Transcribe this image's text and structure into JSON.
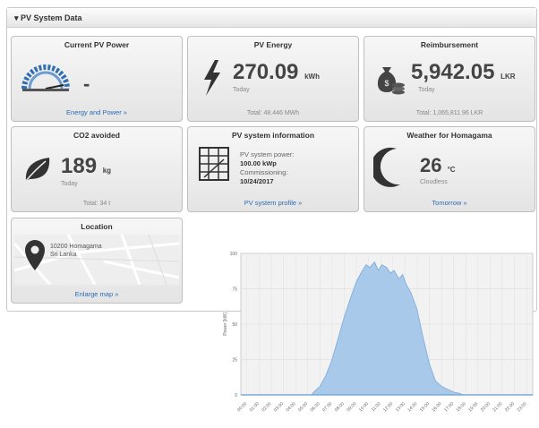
{
  "panel": {
    "title": "▾ PV System Data"
  },
  "cards": {
    "current_power": {
      "title": "Current PV Power",
      "value": "-",
      "link": "Energy and Power »"
    },
    "pv_energy": {
      "title": "PV Energy",
      "value": "270.09",
      "unit": "kWh",
      "period": "Today",
      "total": "Total: 48.446 MWh"
    },
    "reimbursement": {
      "title": "Reimbursement",
      "value": "5,942.05",
      "unit": "LKR",
      "period": "Today",
      "total": "Total: 1,065,811.96 LKR"
    },
    "co2": {
      "title": "CO2 avoided",
      "value": "189",
      "unit": "kg",
      "period": "Today",
      "total": "Total: 34 t"
    },
    "system_info": {
      "title": "PV system information",
      "line1": "PV system power:",
      "line2": "100.00 kWp",
      "line3": "Commissioning:",
      "line4": "10/24/2017",
      "link": "PV system profile »"
    },
    "weather": {
      "title": "Weather for Homagama",
      "value": "26",
      "unit": "°C",
      "condition": "Cloudless",
      "link": "Tomorrow »"
    },
    "location": {
      "title": "Location",
      "line1": "10200 Homagama",
      "line2": "Sri Lanka",
      "link": "Enlarge map »"
    }
  },
  "colors": {
    "accent_link": "#2a6bb5",
    "chart_fill": "#a9c9ea",
    "chart_stroke": "#7ba9d8"
  },
  "icons": {
    "gauge": "gauge-icon",
    "bolt": "lightning-bolt-icon",
    "money": "money-bag-icon",
    "leaf": "leaf-icon",
    "solar": "solar-panel-icon",
    "moon": "moon-icon",
    "pin": "location-pin-icon"
  },
  "chart_data": {
    "type": "area",
    "ylabel": "Power [kW]",
    "yticks": [
      "0",
      "25",
      "50",
      "75",
      "100"
    ],
    "ylim": [
      0,
      100
    ],
    "xticks": [
      "00:00",
      "01:00",
      "02:00",
      "03:00",
      "04:00",
      "05:00",
      "06:00",
      "07:00",
      "08:00",
      "09:00",
      "10:00",
      "11:00",
      "12:00",
      "13:00",
      "14:00",
      "15:00",
      "16:00",
      "17:00",
      "18:00",
      "19:00",
      "20:00",
      "21:00",
      "22:00",
      "23:00"
    ],
    "x": [
      0,
      5.8,
      6,
      6.5,
      7,
      7.5,
      8,
      8.5,
      9,
      9.5,
      10,
      10.3,
      10.6,
      11,
      11.3,
      11.6,
      12,
      12.3,
      12.6,
      13,
      13.3,
      13.6,
      14,
      14.5,
      15,
      15.5,
      16,
      16.5,
      17,
      17.5,
      18,
      18.3,
      24
    ],
    "values": [
      0,
      0,
      2,
      6,
      14,
      25,
      40,
      55,
      68,
      80,
      88,
      92,
      90,
      94,
      88,
      92,
      90,
      86,
      88,
      82,
      85,
      78,
      72,
      60,
      40,
      22,
      10,
      6,
      4,
      2,
      1,
      0,
      0
    ],
    "grid": true
  }
}
